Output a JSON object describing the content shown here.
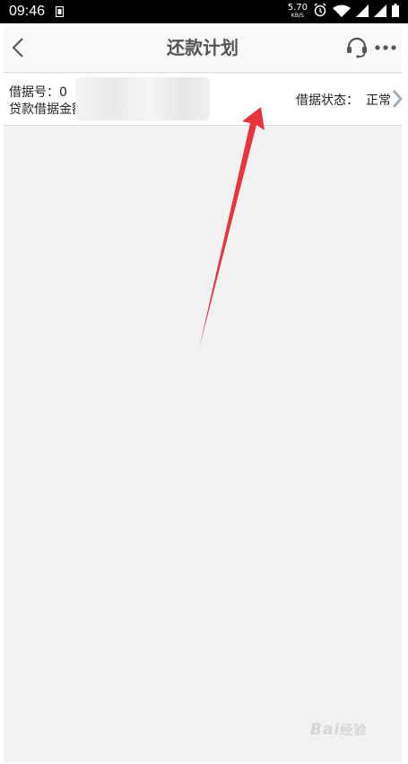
{
  "status_bar": {
    "time": "09:46",
    "net_speed": "5.70",
    "net_speed_unit": "KB/S",
    "icons": [
      "sim-card-icon",
      "alarm-icon",
      "wifi-icon",
      "signal-icon",
      "signal-icon",
      "battery-icon"
    ]
  },
  "nav": {
    "title": "还款计划",
    "back_icon": "chevron-left-icon",
    "service_icon": "headset-icon",
    "more_icon": "more-dots-icon"
  },
  "loan": {
    "loan_no_label": "借据号：",
    "loan_no_value": "0",
    "amount_label": "贷款借据金额：",
    "status_label": "借据状态：",
    "status_value": "正常"
  },
  "watermark": {
    "text": "Bai",
    "text2": "经验"
  },
  "colors": {
    "accent_arrow": "#e8353d",
    "nav_background": "#f9f9f9",
    "page_background": "#f2f2f2"
  }
}
